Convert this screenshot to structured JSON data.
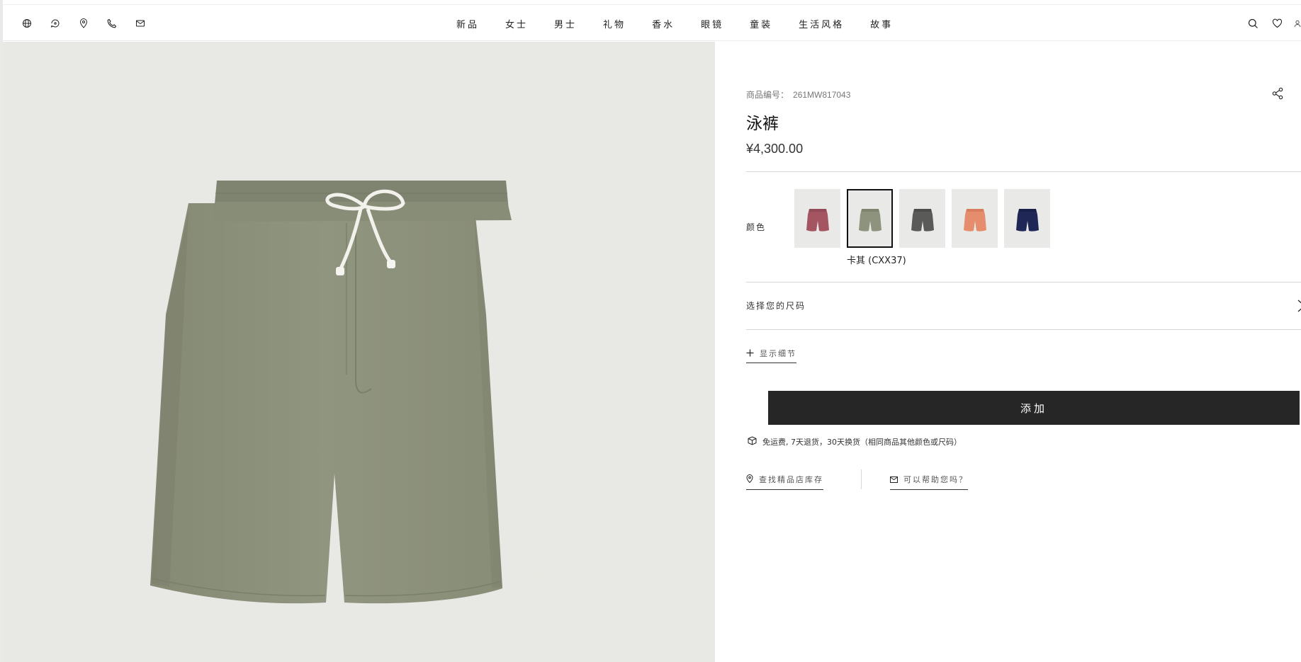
{
  "header": {
    "utility_icons": [
      "globe-icon",
      "help-chat-icon",
      "location-pin-icon",
      "phone-icon",
      "mail-icon"
    ],
    "nav": [
      "新品",
      "女士",
      "男士",
      "礼物",
      "香水",
      "眼镜",
      "童装",
      "生活风格",
      "故事"
    ],
    "right_icons": [
      "search-icon",
      "heart-icon",
      "user-icon"
    ]
  },
  "product": {
    "sku_label": "商品编号：",
    "sku": "261MW817043",
    "title": "泳裤",
    "price": "¥4,300.00",
    "color_label": "颜色",
    "colors": [
      {
        "hex": "#a55562",
        "selected": false
      },
      {
        "hex": "#8e937d",
        "selected": true
      },
      {
        "hex": "#5a5b58",
        "selected": false
      },
      {
        "hex": "#e58d6c",
        "selected": false
      },
      {
        "hex": "#1f2757",
        "selected": false
      }
    ],
    "selected_color_name": "卡其 (CXX37)",
    "size_label": "选择您的尺码",
    "details_label": "显示细节",
    "add_button": "添加",
    "shipping_text": "免运费, 7天退货，30天换货（相同商品其他颜色或尺码）",
    "store_link": "查找精品店库存",
    "help_link": "可以帮助您吗？"
  },
  "colors": {
    "accent_dark": "#262626",
    "gallery_bg": "#e8e8e5",
    "shorts": "#8e937d"
  }
}
